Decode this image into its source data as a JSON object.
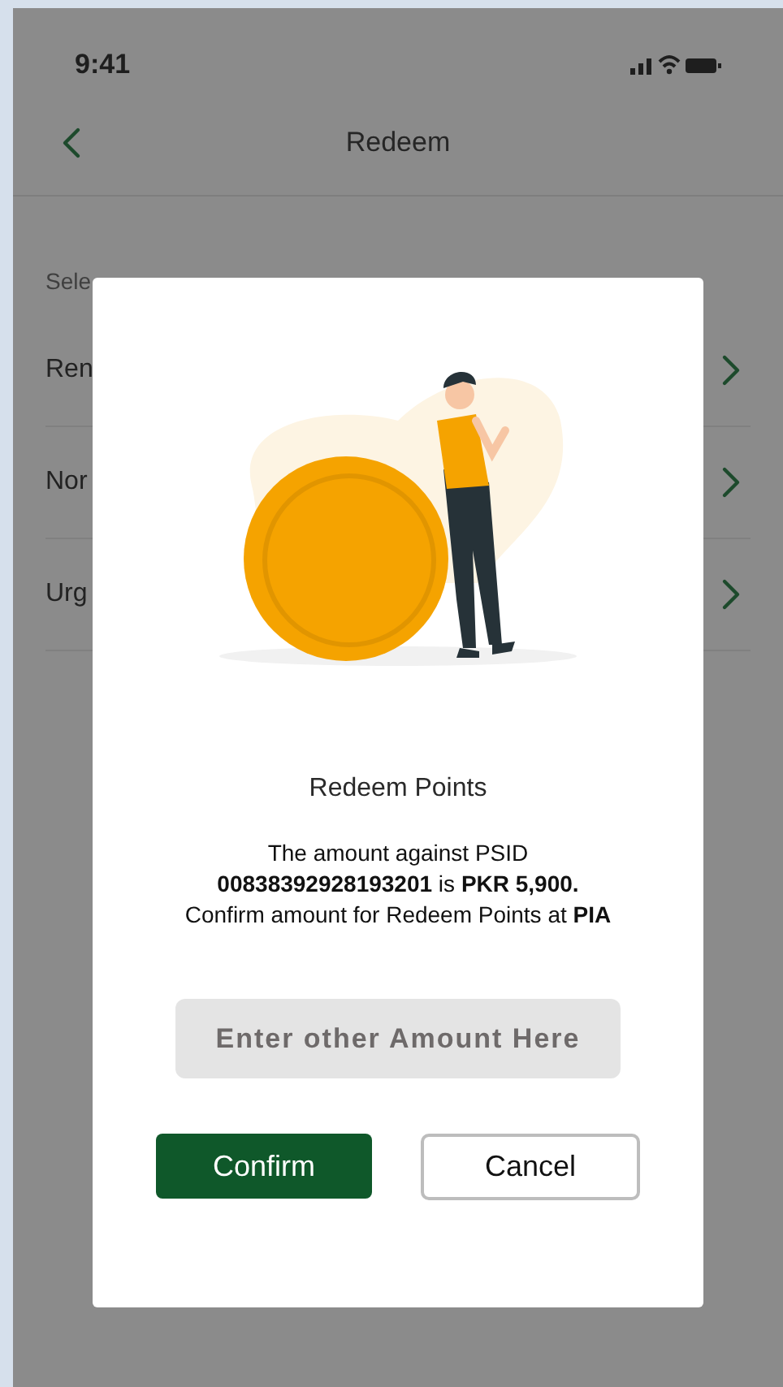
{
  "status_bar": {
    "time": "9:41"
  },
  "header": {
    "title": "Redeem"
  },
  "background_list": {
    "caption": "Sele",
    "items": [
      {
        "label": "Ren"
      },
      {
        "label": "Nor"
      },
      {
        "label": "Urg"
      }
    ]
  },
  "dialog": {
    "title": "Redeem Points",
    "message_lines": [
      "The amount against PSID",
      "**00838392928193201** is **PKR 5,900.**",
      "Confirm amount for Redeem Points at **PIA**"
    ],
    "amount_field": {
      "placeholder": "Enter other Amount Here"
    },
    "buttons": [
      {
        "label": "Confirm",
        "kind": "primary"
      },
      {
        "label": "Cancel",
        "kind": "secondary"
      }
    ]
  }
}
